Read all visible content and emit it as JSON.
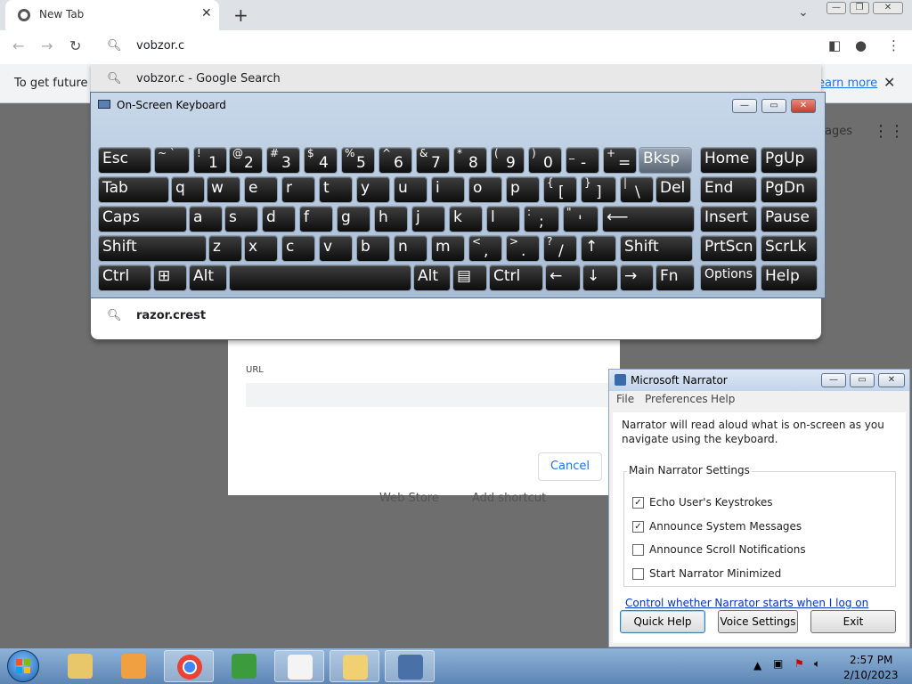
{
  "browser": {
    "tab_title": "New Tab",
    "tab_close": "✕",
    "new_tab": "+",
    "omnibox_text": "vobzor.c",
    "suggestions": [
      {
        "text": "vobzor.c - Google Search"
      },
      {
        "bold": "razor.c",
        "rest": "rest"
      }
    ],
    "infobar_text": "To get future G",
    "infobar_link": "earn more",
    "apps_partial": "ages"
  },
  "dialog": {
    "url_label": "URL",
    "cancel_label": "Cancel",
    "web_store": "Web Store",
    "add_shortcut": "Add shortcut"
  },
  "osk": {
    "title": "On-Screen Keyboard",
    "rows": [
      [
        {
          "m": "Esc"
        },
        {
          "s": "~ `"
        },
        {
          "s": "!",
          "b": "1"
        },
        {
          "s": "@",
          "b": "2"
        },
        {
          "s": "#",
          "b": "3"
        },
        {
          "s": "$",
          "b": "4"
        },
        {
          "s": "%",
          "b": "5"
        },
        {
          "s": "^",
          "b": "6"
        },
        {
          "s": "&",
          "b": "7"
        },
        {
          "s": "*",
          "b": "8"
        },
        {
          "s": "(",
          "b": "9"
        },
        {
          "s": ")",
          "b": "0"
        },
        {
          "s": "_",
          "b": "-"
        },
        {
          "s": "+",
          "b": "="
        },
        {
          "m": "Bksp"
        },
        {
          "m": "Home"
        },
        {
          "m": "PgUp"
        }
      ],
      [
        {
          "m": "Tab"
        },
        {
          "m": "q"
        },
        {
          "m": "w"
        },
        {
          "m": "e"
        },
        {
          "m": "r"
        },
        {
          "m": "t"
        },
        {
          "m": "y"
        },
        {
          "m": "u"
        },
        {
          "m": "i"
        },
        {
          "m": "o"
        },
        {
          "m": "p"
        },
        {
          "s": "{",
          "b": "["
        },
        {
          "s": "}",
          "b": "]"
        },
        {
          "s": "|",
          "b": "\\"
        },
        {
          "m": "Del"
        },
        {
          "m": "End"
        },
        {
          "m": "PgDn"
        }
      ],
      [
        {
          "m": "Caps"
        },
        {
          "m": "a"
        },
        {
          "m": "s"
        },
        {
          "m": "d"
        },
        {
          "m": "f"
        },
        {
          "m": "g"
        },
        {
          "m": "h"
        },
        {
          "m": "j"
        },
        {
          "m": "k"
        },
        {
          "m": "l"
        },
        {
          "s": ":",
          "b": ";"
        },
        {
          "s": "\"",
          "b": "'"
        },
        {
          "m": "⟵"
        },
        {
          "m": "Insert"
        },
        {
          "m": "Pause"
        }
      ],
      [
        {
          "m": "Shift"
        },
        {
          "m": "z"
        },
        {
          "m": "x"
        },
        {
          "m": "c"
        },
        {
          "m": "v"
        },
        {
          "m": "b"
        },
        {
          "m": "n"
        },
        {
          "m": "m"
        },
        {
          "s": "<",
          "b": ","
        },
        {
          "s": ">",
          "b": "."
        },
        {
          "s": "?",
          "b": "/"
        },
        {
          "m": "↑"
        },
        {
          "m": "Shift"
        },
        {
          "m": "PrtScn"
        },
        {
          "m": "ScrLk"
        }
      ],
      [
        {
          "m": "Ctrl"
        },
        {
          "m": "⊞"
        },
        {
          "m": "Alt"
        },
        {
          "m": ""
        },
        {
          "m": "Alt"
        },
        {
          "m": "▤"
        },
        {
          "m": "Ctrl"
        },
        {
          "m": "←"
        },
        {
          "m": "↓"
        },
        {
          "m": "→"
        },
        {
          "m": "Fn"
        },
        {
          "m": "Options"
        },
        {
          "m": "Help"
        }
      ]
    ]
  },
  "narrator": {
    "title": "Microsoft Narrator",
    "menu": [
      "File",
      "Preferences",
      "Help"
    ],
    "description": "Narrator will read aloud what is on-screen as you navigate using the keyboard.",
    "group_title": "Main Narrator Settings",
    "options": [
      {
        "label": "Echo User's Keystrokes",
        "checked": "✓"
      },
      {
        "label": "Announce System Messages",
        "checked": "✓"
      },
      {
        "label": "Announce Scroll Notifications",
        "checked": ""
      },
      {
        "label": "Start Narrator Minimized",
        "checked": ""
      }
    ],
    "link": "Control whether Narrator starts when I log on",
    "buttons": [
      "Quick Help",
      "Voice Settings",
      "Exit"
    ]
  },
  "taskbar": {
    "time": "2:57 PM",
    "date": "2/10/2023"
  },
  "colors": {
    "accent": "#1a73e8",
    "taskbar": "#6b93c2"
  }
}
